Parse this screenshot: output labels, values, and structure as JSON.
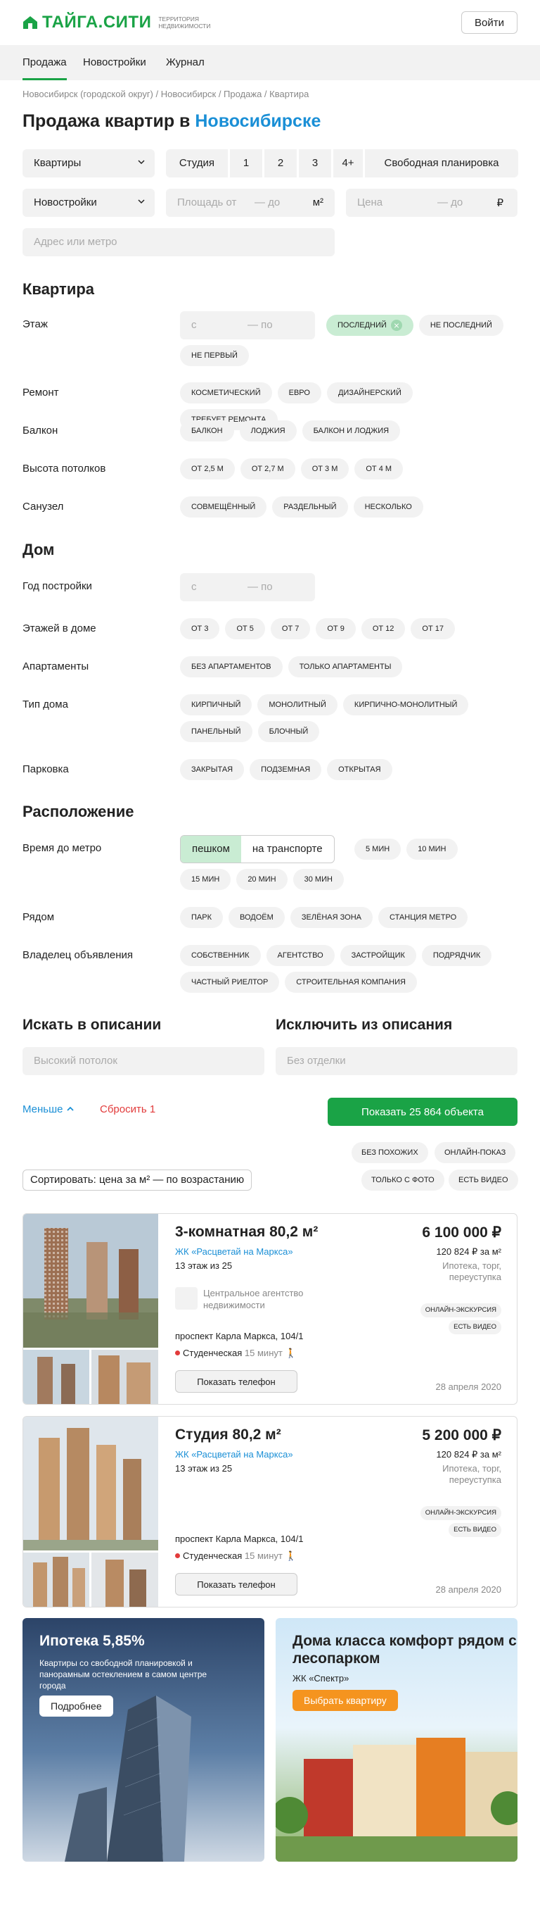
{
  "header": {
    "logo_text": "ТАЙГА.СИТИ",
    "logo_sub": "ТЕРРИТОРИЯ НЕДВИЖИМОСТИ",
    "login_label": "Войти",
    "brand_color": "#1aa346"
  },
  "nav": {
    "items": [
      {
        "label": "Продажа",
        "active": true
      },
      {
        "label": "Новостройки",
        "active": false
      },
      {
        "label": "Журнал",
        "active": false
      }
    ]
  },
  "breadcrumb": "Новосибирск (городской округ) / Новосибирск / Продажа / Квартира",
  "page_title_prefix": "Продажа квартир в ",
  "page_title_city": "Новосибирске",
  "filters": {
    "type_select": "Квартиры",
    "rooms": [
      "Студия",
      "1",
      "2",
      "3",
      "4+",
      "Свободная планировка"
    ],
    "market_select": "Новостройки",
    "area_from": "Площадь от",
    "area_to": "— до",
    "area_unit": "м²",
    "price_from": "Цена",
    "price_to": "— до",
    "price_unit": "₽",
    "address_placeholder": "Адрес или метро"
  },
  "flat": {
    "title": "Квартира",
    "floor_label": "Этаж",
    "floor_from": "с",
    "floor_to": "— по",
    "floor_chips": [
      {
        "label": "последний",
        "on": true
      },
      {
        "label": "не последний",
        "on": false
      },
      {
        "label": "не первый",
        "on": false
      }
    ],
    "repair_label": "Ремонт",
    "repair_chips": [
      "косметический",
      "евро",
      "дизайнерский",
      "требует ремонта"
    ],
    "balcony_label": "Балкон",
    "balcony_chips": [
      "балкон",
      "лоджия",
      "балкон и лоджия"
    ],
    "ceiling_label": "Высота потолков",
    "ceiling_chips": [
      "от 2,5 м",
      "от 2,7 м",
      "от 3 м",
      "от 4 м"
    ],
    "bath_label": "Санузел",
    "bath_chips": [
      "совмещённый",
      "раздельный",
      "несколько"
    ]
  },
  "house": {
    "title": "Дом",
    "year_label": "Год постройки",
    "year_from": "с",
    "year_to": "— по",
    "floors_label": "Этажей в доме",
    "floors_chips": [
      "от 3",
      "от 5",
      "от 7",
      "от 9",
      "от 12",
      "от 17"
    ],
    "apart_label": "Апартаменты",
    "apart_chips": [
      "без апартаментов",
      "только апартаменты"
    ],
    "type_label": "Тип дома",
    "type_chips": [
      "кирпичный",
      "монолитный",
      "кирпично-монолитный",
      "панельный",
      "блочный"
    ],
    "parking_label": "Парковка",
    "parking_chips": [
      "закрытая",
      "подземная",
      "открытая"
    ]
  },
  "location": {
    "title": "Расположение",
    "metro_label": "Время до метро",
    "toggle": [
      "пешком",
      "на транспорте"
    ],
    "metro_chips": [
      "5 мин",
      "10 мин",
      "15 мин",
      "20 мин",
      "30 мин"
    ],
    "near_label": "Рядом",
    "near_chips": [
      "парк",
      "водоём",
      "зелёная зона",
      "станция метро"
    ],
    "owner_label": "Владелец объявления",
    "owner_chips": [
      "собственник",
      "агентство",
      "застройщик",
      "подрядчик",
      "частный риелтор",
      "строительная компания"
    ]
  },
  "search": {
    "include_title": "Искать в описании",
    "include_placeholder": "Высокий потолок",
    "exclude_title": "Исключить из описания",
    "exclude_placeholder": "Без отделки"
  },
  "actions": {
    "less": "Меньше",
    "reset": "Сбросить 1",
    "show": "Показать 25 864 объекта"
  },
  "quick_filters": [
    "без похожих",
    "онлайн-показ",
    "только с фото",
    "есть видео"
  ],
  "sort_label": "Сортировать: цена за м² — по возрастанию",
  "listings": [
    {
      "title": "3-комнатная 80,2 м²",
      "complex": "ЖК «Расцветай на Маркса»",
      "floor": "13 этаж из 25",
      "agency": "Центральное агентство недвижимости",
      "address": "проспект Карла Маркса, 104/1",
      "metro": "Студенческая",
      "metro_time": "15 минут",
      "phone_label": "Показать телефон",
      "price": "6 100 000 ₽",
      "price_per_m": "120 824 ₽ за м²",
      "conditions": "Ипотека, торг, переуступка",
      "tags": [
        "онлайн-экскурсия",
        "есть видео"
      ],
      "date": "28 апреля 2020"
    },
    {
      "title": "Студия 80,2 м²",
      "complex": "ЖК «Расцветай на Маркса»",
      "floor": "13 этаж из 25",
      "agency": "",
      "address": "проспект Карла Маркса, 104/1",
      "metro": "Студенческая",
      "metro_time": "15 минут",
      "phone_label": "Показать телефон",
      "price": "5 200 000 ₽",
      "price_per_m": "120 824 ₽ за м²",
      "conditions": "Ипотека, торг, переуступка",
      "tags": [
        "онлайн-экскурсия",
        "есть видео"
      ],
      "date": "28 апреля 2020"
    }
  ],
  "banners": [
    {
      "title": "Ипотека 5,85%",
      "subtitle": "Квартиры со свободной планировкой и панорамным остеклением в самом центре города",
      "button": "Подробнее"
    },
    {
      "title": "Дома класса комфорт рядом с лесопарком",
      "subtitle": "ЖК «Спектр»",
      "button": "Выбрать квартиру"
    }
  ]
}
